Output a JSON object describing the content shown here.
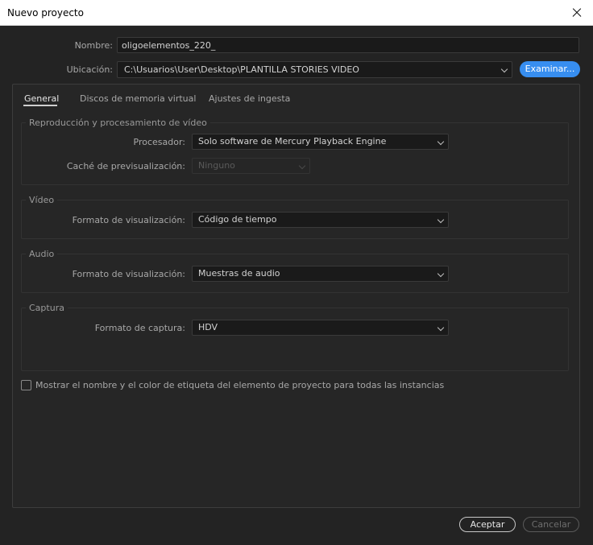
{
  "window": {
    "title": "Nuevo proyecto"
  },
  "name": {
    "label": "Nombre:",
    "value": "oligoelementos_220_"
  },
  "location": {
    "label": "Ubicación:",
    "value": "C:\\Usuarios\\User\\Desktop\\PLANTILLA STORIES VIDEO",
    "browse_label": "Examinar..."
  },
  "tabs": [
    {
      "label": "General",
      "active": true
    },
    {
      "label": "Discos de memoria virtual",
      "active": false
    },
    {
      "label": "Ajustes de ingesta",
      "active": false
    }
  ],
  "groups": {
    "playback": {
      "title": "Reproducción y procesamiento de vídeo",
      "processor_label": "Procesador:",
      "processor_value": "Solo software de Mercury Playback Engine",
      "preview_cache_label": "Caché de previsualización:",
      "preview_cache_value": "Ninguno"
    },
    "video": {
      "title": "Vídeo",
      "display_label": "Formato de visualización:",
      "display_value": "Código de tiempo"
    },
    "audio": {
      "title": "Audio",
      "display_label": "Formato de visualización:",
      "display_value": "Muestras de audio"
    },
    "capture": {
      "title": "Captura",
      "format_label": "Formato de captura:",
      "format_value": "HDV"
    }
  },
  "show_label_checkbox": {
    "label": "Mostrar el nombre y el color de etiqueta del elemento de proyecto para todas las instancias",
    "checked": false
  },
  "footer": {
    "ok_label": "Aceptar",
    "cancel_label": "Cancelar"
  },
  "colors": {
    "accent": "#378ef0",
    "background": "#232323",
    "titlebar": "#ffffff"
  }
}
